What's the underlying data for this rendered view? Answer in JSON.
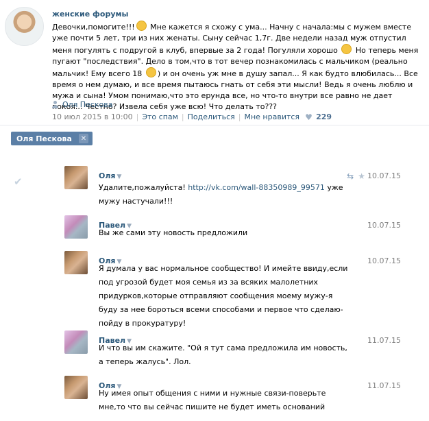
{
  "post": {
    "author": "женские форумы",
    "text_parts": {
      "p1": "Девочки,помогите!!!",
      "p2": " Мне кажется я схожу с ума... Начну с начала:мы с мужем вместе уже почти 5 лет, три из них женаты. Сыну сейчас 1,7г. Две недели назад муж отпустил меня погулять с подругой в клуб, впервые за 2 года! Погуляли хорошо",
      "p3": " Но теперь меня пугают \"последствия\". Дело в том,что в тот вечер познакомилась с мальчиком (реально мальчик! Ему всего 18",
      "p4": ") и он очень уж мне в душу запал... Я как будто влюбилась... Все время о нем думаю, и все время пытаюсь гнать от себя эти мысли! Ведь я очень люблю и мужа и сына! Умом понимаю,что это ерунда все, но что-то внутри все равно не дает покоя... Честно? Извела себя уже всю! Что делать то???"
    },
    "signer": "Оля Пескова",
    "date": "10 июл 2015 в 10:00",
    "spam_label": "Это спам",
    "share_label": "Поделиться",
    "like_label": "Мне нравится",
    "like_count": "229"
  },
  "tag": {
    "label": "Оля Пескова"
  },
  "messages": [
    {
      "name": "Оля",
      "date": "10.07.15",
      "text": "Удалите,пожалуйста! ",
      "link": "http://vk.com/wall-88350989_99571",
      "text_after": " уже мужу настучали!!!"
    },
    {
      "name": "Павел",
      "date": "10.07.15",
      "text": "Вы же сами эту новость предложили"
    },
    {
      "name": "Оля",
      "date": "10.07.15",
      "text": "Я думала у вас нормальное сообщество! И имейте ввиду,если под угрозой будет моя семья из за всяких малолетних придурков,которые отправляют сообщения моему мужу-я буду за нее бороться всеми способами и первое что сделаю-пойду в прокуратуру!"
    },
    {
      "name": "Павел",
      "date": "11.07.15",
      "text": "И что вы им скажите. \"Ой я тут сама предложила им новость, а теперь жалусь\". Лол."
    },
    {
      "name": "Оля",
      "date": "11.07.15",
      "text": "Ну имея опыт общения с ними и нужные связи-поверьте мне,то что вы сейчас пишите не будет иметь оснований"
    }
  ]
}
